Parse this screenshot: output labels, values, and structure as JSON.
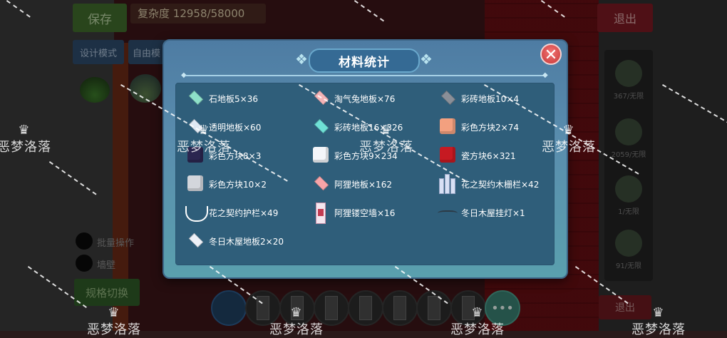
{
  "background": {
    "save_label": "保存",
    "complexity_label": "复杂度",
    "complexity_value": "12958/58000",
    "design_mode_label": "设计模式",
    "free_label": "自由模",
    "exit_label": "退出",
    "batch_label": "批量操作",
    "wall_label": "墙壁",
    "switch_label": "规格切换",
    "right_panel": [
      "367/无限",
      "2059/无限",
      "1/无限",
      "91/无限"
    ],
    "bottom_right_label": "退出",
    "more_label": "•••"
  },
  "modal": {
    "title": "材料统计",
    "close_glyph": "✕",
    "items": [
      {
        "name": "石地板5×36",
        "icon": "floor-tile-icon",
        "color": "#8ee0c8"
      },
      {
        "name": "淘气兔地板×76",
        "icon": "floor-tile-icon",
        "color": "#f4b3b6"
      },
      {
        "name": "彩砖地板10×4",
        "icon": "floor-tile-icon",
        "color": "#8a8f98"
      },
      {
        "name": "透明地板×60",
        "icon": "floor-tile-icon",
        "color": "#dfe8f3"
      },
      {
        "name": "彩砖地板16×326",
        "icon": "floor-tile-icon",
        "color": "#6fe0d6"
      },
      {
        "name": "彩色方块2×74",
        "icon": "cube-icon",
        "color": "#f3a07f"
      },
      {
        "name": "彩色方块8×3",
        "icon": "cube-icon",
        "color": "#2b2650"
      },
      {
        "name": "彩色方块9×234",
        "icon": "cube-icon",
        "color": "#f4f6fa"
      },
      {
        "name": "瓷方块6×321",
        "icon": "cube-icon",
        "color": "#c61a22"
      },
      {
        "name": "彩色方块10×2",
        "icon": "cube-icon",
        "color": "#d3d6dc"
      },
      {
        "name": "阿狸地板×162",
        "icon": "floor-tile-icon",
        "color": "#f7a4a8"
      },
      {
        "name": "花之契约木栅栏×42",
        "icon": "fence-icon",
        "color": "#d8e0f4"
      },
      {
        "name": "花之契约护栏×49",
        "icon": "railing-icon",
        "color": "#ffffff"
      },
      {
        "name": "阿狸镂空墙×16",
        "icon": "lattice-wall-icon",
        "color": "#f4e6ef"
      },
      {
        "name": "冬日木屋挂灯×1",
        "icon": "hanging-lamp-icon",
        "color": "#2c3a46"
      },
      {
        "name": "冬日木屋地板2×20",
        "icon": "floor-tile-icon",
        "color": "#eef1f8"
      }
    ]
  },
  "watermark": {
    "text": "恶梦洛落"
  }
}
